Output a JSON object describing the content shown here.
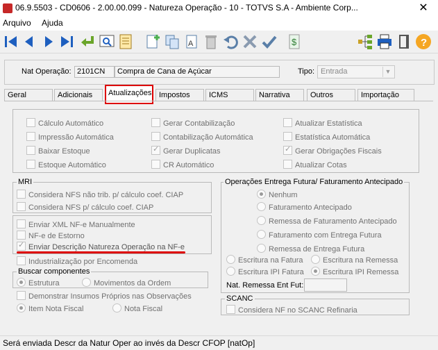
{
  "window": {
    "title": "06.9.5503 - CD0606 - 2.00.00.099 - Natureza Operação - 10 - TOTVS S.A - Ambiente Corp...",
    "close": "✕"
  },
  "menu": [
    "Arquivo",
    "Ajuda"
  ],
  "toolbar_icons": [
    "first-icon",
    "prev-icon",
    "next-icon",
    "last-icon",
    "return-icon",
    "search-icon",
    "report-icon",
    "new-icon",
    "copy-icon",
    "text-icon",
    "delete-icon",
    "undo-icon",
    "cancel-icon",
    "confirm-icon",
    "dollar-icon",
    "tree-icon",
    "print-icon",
    "exit-icon",
    "help-icon"
  ],
  "header": {
    "nat_label": "Nat Operação:",
    "nat_code": "2101CN",
    "nat_desc": "Compra de Cana de Açúcar",
    "tipo_label": "Tipo:",
    "tipo_value": "Entrada"
  },
  "tabs": [
    "Geral",
    "Adicionais",
    "Atualizações",
    "Impostos",
    "ICMS",
    "Narrativa",
    "Outros",
    "Importação"
  ],
  "atualizacoes": [
    {
      "label": "Cálculo Automático",
      "checked": false
    },
    {
      "label": "Gerar Contabilização",
      "checked": false
    },
    {
      "label": "Atualizar Estatística",
      "checked": false
    },
    {
      "label": "Impressão Automática",
      "checked": false
    },
    {
      "label": "Contabilização Automática",
      "checked": false
    },
    {
      "label": "Estatística Automática",
      "checked": false
    },
    {
      "label": "Baixar Estoque",
      "checked": false
    },
    {
      "label": "Gerar Duplicatas",
      "checked": true
    },
    {
      "label": "Gerar Obrigações Fiscais",
      "checked": true
    },
    {
      "label": "Estoque Automático",
      "checked": false
    },
    {
      "label": "CR Automático",
      "checked": false
    },
    {
      "label": "Atualizar Cotas",
      "checked": false
    }
  ],
  "mri": {
    "legend": "MRI",
    "items": [
      "Considera NFS não trib. p/ cálculo coef. CIAP",
      "Considera NFS p/ cálculo coef. CIAP"
    ]
  },
  "nfe": [
    {
      "label": "Enviar XML NF-e Manualmente",
      "checked": false
    },
    {
      "label": "NF-e de Estorno",
      "checked": false
    },
    {
      "label": "Enviar Descrição Natureza Operação na NF-e",
      "checked": true
    }
  ],
  "industrializacao": "Industrialização por Encomenda",
  "buscar": {
    "legend": "Buscar componentes",
    "options": [
      "Estrutura",
      "Movimentos da Ordem"
    ],
    "selected": 0
  },
  "demonstrar": "Demonstrar Insumos Próprios nas Observações",
  "item_nota": {
    "options": [
      "Item Nota Fiscal",
      "Nota Fiscal"
    ],
    "selected": 0
  },
  "entrega": {
    "legend": "Operações Entrega Futura/ Faturamento Antecipado",
    "options": [
      "Nenhum",
      "Faturamento Antecipado",
      "Remessa de Faturamento Antecipado",
      "Faturamento com Entrega Futura",
      "Remessa de Entrega Futura"
    ],
    "selected": 0,
    "esc_fatura": "Escritura na Fatura",
    "esc_remessa": "Escritura na Remessa",
    "ipi_fatura": "Escritura IPI Fatura",
    "ipi_remessa": "Escritura IPI Remessa",
    "nat_remessa_label": "Nat. Remessa Ent Fut:",
    "nat_remessa_value": ""
  },
  "scanc": {
    "legend": "SCANC",
    "item": "Considera NF no SCANC Refinaria"
  },
  "status": "Será enviada Descr da Natur Oper ao invés da Descr CFOP [natOp]"
}
